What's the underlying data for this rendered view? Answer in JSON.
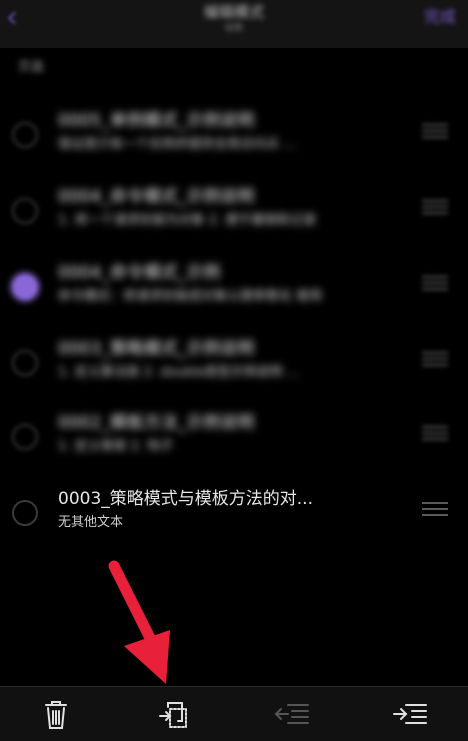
{
  "nav": {
    "back_glyph": "‹",
    "title": "编辑模式",
    "subtitle": "0/6",
    "done_label": "完成"
  },
  "section": {
    "header": "页面"
  },
  "rows": [
    {
      "title": "0005_单例模式_示例说明",
      "subtitle": "保证类只有一个实例并提供全局访问点 …",
      "selected": false,
      "blurred": true
    },
    {
      "title": "0004_命令模式_示例说明",
      "subtitle": "1. 将一个请求封装为对象 2. 便于撤销和记录",
      "selected": false,
      "blurred": true
    },
    {
      "title": "0004_命令模式_示例",
      "subtitle": "命令模式：将请求封装成对象以便参数化 使用",
      "selected": true,
      "blurred": true
    },
    {
      "title": "0003_策略模式_示例说明",
      "subtitle": "1. 定义算法族 2. double类型示例说明 …",
      "selected": false,
      "blurred": true
    },
    {
      "title": "0002_模板方法_示例说明",
      "subtitle": "1. 定义骨架 2. 钩子",
      "selected": false,
      "blurred": true
    },
    {
      "title": "0003_策略模式与模板方法的对...",
      "subtitle": "无其他文本",
      "selected": false,
      "blurred": false
    }
  ],
  "toolbar": {
    "items": [
      "trash-icon",
      "move-to-page-icon",
      "outdent-icon",
      "indent-icon"
    ]
  },
  "colors": {
    "accent": "#8a67d6",
    "annotation_arrow": "#e8203a"
  }
}
